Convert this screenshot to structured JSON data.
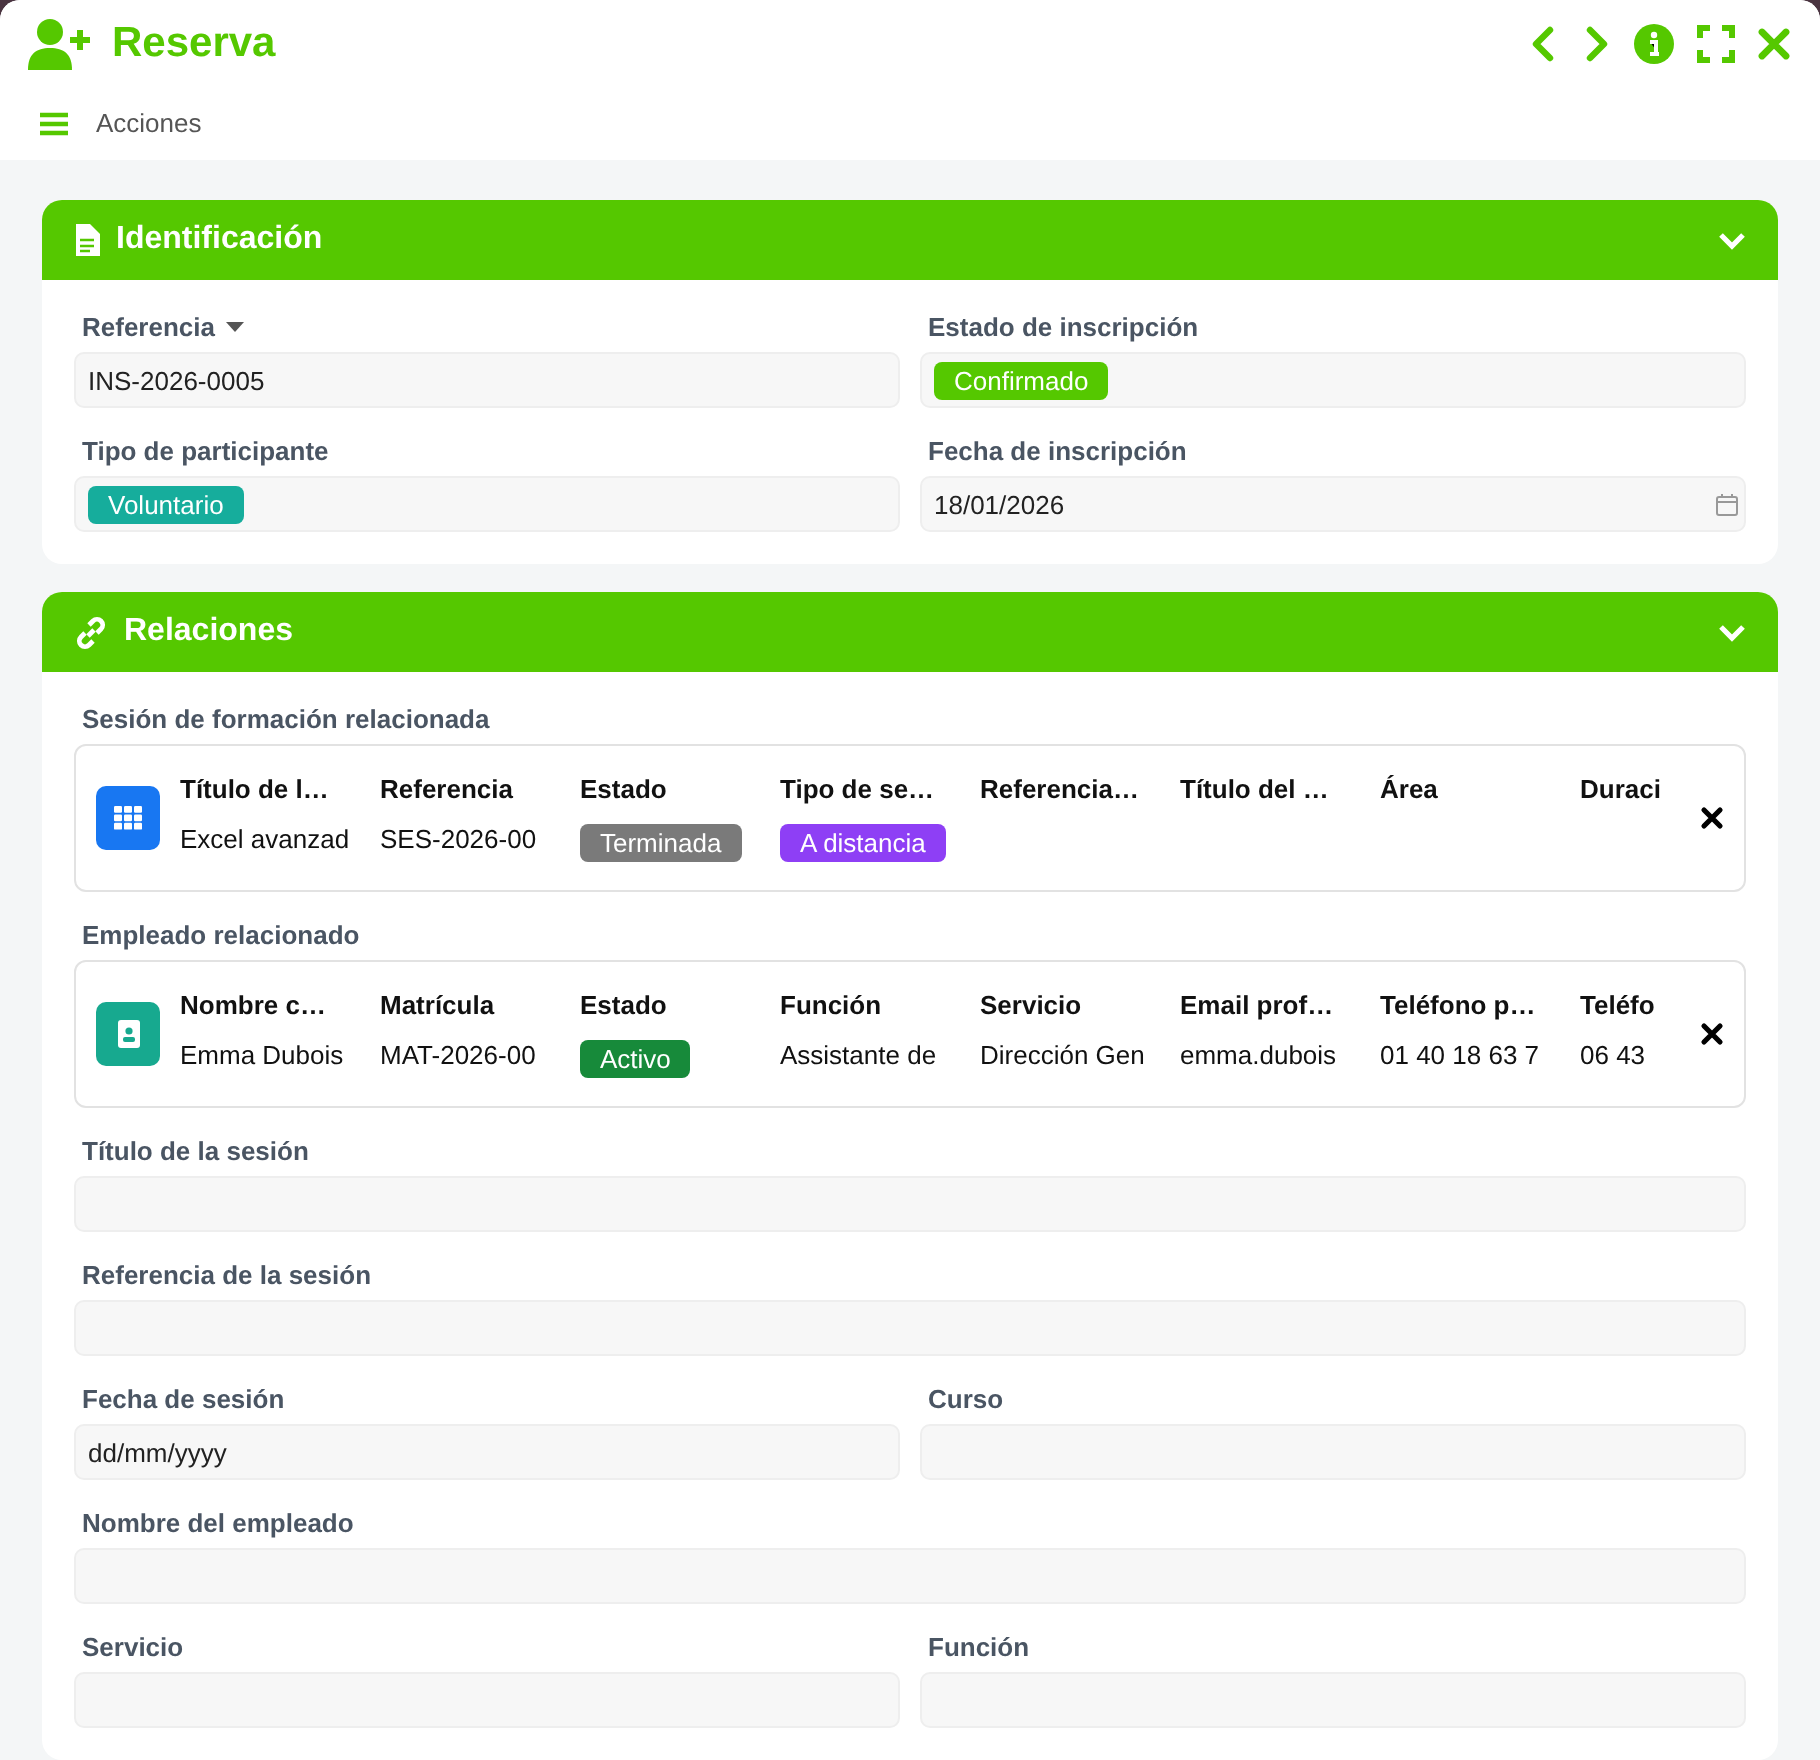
{
  "window": {
    "title": "Reserva"
  },
  "actions": {
    "label": "Acciones"
  },
  "sections": [
    {
      "title": "Identificación",
      "kind": "document",
      "expanded": true,
      "rows": [
        [
          {
            "label": "Referencia",
            "kind": "select",
            "value": "INS-2026-0005"
          },
          {
            "label": "Estado de inscripción",
            "kind": "badge",
            "value": "Confirmado",
            "color": "#55c800"
          }
        ],
        [
          {
            "label": "Tipo de participante",
            "kind": "badge",
            "value": "Voluntario",
            "color": "#16ad9c"
          },
          {
            "label": "Fecha de inscripción",
            "kind": "date",
            "value": "18/01/2026"
          }
        ]
      ]
    },
    {
      "title": "Relaciones",
      "kind": "link",
      "expanded": true,
      "related": [
        {
          "label": "Sesión de formación relacionada",
          "kind": "session",
          "columns": [
            "Título de l…",
            "Referencia",
            "Estado",
            "Tipo de se…",
            "Referencia…",
            "Título del …",
            "Área",
            "Duraci"
          ],
          "cells": [
            {
              "kind": "text",
              "value": "Excel avanzad"
            },
            {
              "kind": "text",
              "value": "SES-2026-00"
            },
            {
              "kind": "badge",
              "value": "Terminada",
              "color": "#7a7a7a"
            },
            {
              "kind": "badge",
              "value": "A distancia",
              "color": "#8e3ff5"
            }
          ]
        },
        {
          "label": "Empleado relacionado",
          "kind": "employee",
          "columns": [
            "Nombre c…",
            "Matrícula",
            "Estado",
            "Función",
            "Servicio",
            "Email prof…",
            "Teléfono p…",
            "Teléfo"
          ],
          "cells": [
            {
              "kind": "text",
              "value": "Emma Dubois"
            },
            {
              "kind": "text",
              "value": "MAT-2026-00"
            },
            {
              "kind": "badge",
              "value": "Activo",
              "color": "#178a3a"
            },
            {
              "kind": "text",
              "value": "Assistante de"
            },
            {
              "kind": "text",
              "value": "Dirección Gen"
            },
            {
              "kind": "text",
              "value": "emma.dubois"
            },
            {
              "kind": "text",
              "value": "01 40 18 63 7"
            },
            {
              "kind": "text",
              "value": "06 43"
            }
          ]
        }
      ],
      "rows": [
        [
          {
            "label": "Título de la sesión",
            "kind": "text"
          }
        ],
        [
          {
            "label": "Referencia de la sesión",
            "kind": "text"
          }
        ],
        [
          {
            "label": "Fecha de sesión",
            "kind": "text",
            "placeholder": "dd/mm/yyyy"
          },
          {
            "label": "Curso",
            "kind": "text"
          }
        ],
        [
          {
            "label": "Nombre del empleado",
            "kind": "text"
          }
        ],
        [
          {
            "label": "Servicio",
            "kind": "text"
          },
          {
            "label": "Función",
            "kind": "text"
          }
        ]
      ]
    }
  ]
}
